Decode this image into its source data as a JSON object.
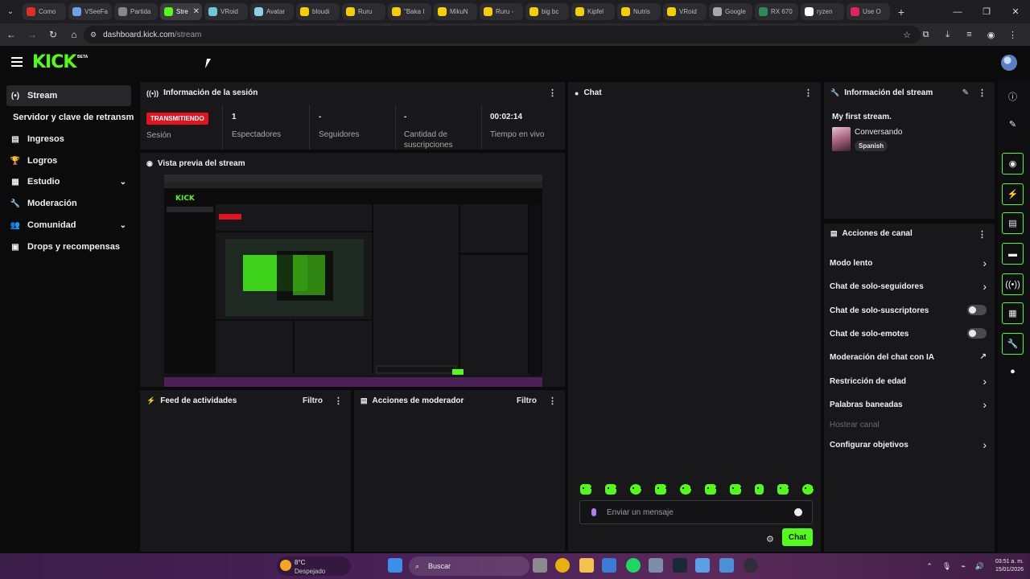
{
  "browser": {
    "tabs": [
      {
        "label": "Como",
        "color": "#e52d27",
        "active": false
      },
      {
        "label": "VSeeFa",
        "color": "#6aa5e8",
        "active": false
      },
      {
        "label": "Partida",
        "color": "#888888",
        "active": false
      },
      {
        "label": "Stre",
        "color": "#53fc18",
        "active": true
      },
      {
        "label": "VRoid",
        "color": "#6ac8d8",
        "active": false
      },
      {
        "label": "Avatar",
        "color": "#8fd0e8",
        "active": false
      },
      {
        "label": "bloudi",
        "color": "#f5d000",
        "active": false
      },
      {
        "label": "Ruru",
        "color": "#f5d000",
        "active": false
      },
      {
        "label": "\"Baka I",
        "color": "#f5d000",
        "active": false
      },
      {
        "label": "MikuN",
        "color": "#f5d000",
        "active": false
      },
      {
        "label": "Ruru -",
        "color": "#f5d000",
        "active": false
      },
      {
        "label": "big bc",
        "color": "#f5d000",
        "active": false
      },
      {
        "label": "Kipfel",
        "color": "#f5d000",
        "active": false
      },
      {
        "label": "Nutris",
        "color": "#f5d000",
        "active": false
      },
      {
        "label": "VRoid",
        "color": "#f5d000",
        "active": false
      },
      {
        "label": "Google",
        "color": "#aaaaaa",
        "active": false
      },
      {
        "label": "RX 670",
        "color": "#2e8b57",
        "active": false
      },
      {
        "label": "ryzen",
        "color": "#ffffff",
        "active": false
      },
      {
        "label": "Use O",
        "color": "#e0245e",
        "active": false
      }
    ],
    "url_domain": "dashboard.kick.com",
    "url_path": "/stream"
  },
  "header": {
    "logo": "KICK",
    "beta": "BETA"
  },
  "sidebar": {
    "items": [
      {
        "label": "Stream",
        "icon": "(•)"
      },
      {
        "label": "Servidor y clave de retransm",
        "icon": ""
      },
      {
        "label": "Ingresos",
        "icon": "▤"
      },
      {
        "label": "Logros",
        "icon": "🏆"
      },
      {
        "label": "Estudio",
        "icon": "▦"
      },
      {
        "label": "Moderación",
        "icon": "🔧"
      },
      {
        "label": "Comunidad",
        "icon": "👥"
      },
      {
        "label": "Drops y recompensas",
        "icon": "▣"
      }
    ]
  },
  "session": {
    "title": "Información de la sesión",
    "status": "TRANSMITIENDO",
    "status_label": "Sesión",
    "viewers": "1",
    "viewers_label": "Espectadores",
    "followers": "-",
    "followers_label": "Seguidores",
    "subs": "-",
    "subs_label": "Cantidad de suscripciones",
    "time": "00:02:14",
    "time_label": "Tiempo en vivo"
  },
  "preview": {
    "title": "Vista previa del stream"
  },
  "activity": {
    "title": "Feed de actividades",
    "filter": "Filtro"
  },
  "modactions": {
    "title": "Acciones de moderador",
    "filter": "Filtro"
  },
  "chat": {
    "title": "Chat",
    "placeholder": "Enviar un mensaje",
    "send": "Chat"
  },
  "streaminfo": {
    "title": "Información del stream",
    "stream_title": "My first stream.",
    "category": "Conversando",
    "language": "Spanish"
  },
  "channel": {
    "title": "Acciones de canal",
    "items": [
      {
        "label": "Modo lento",
        "ctl": "arrow"
      },
      {
        "label": "Chat de solo-seguidores",
        "ctl": "arrow"
      },
      {
        "label": "Chat de solo-suscriptores",
        "ctl": "toggle"
      },
      {
        "label": "Chat de solo-emotes",
        "ctl": "toggle"
      },
      {
        "label": "Moderación del chat con IA",
        "ctl": "external"
      },
      {
        "label": "Restricción de edad",
        "ctl": "arrow"
      },
      {
        "label": "Palabras baneadas",
        "ctl": "arrow"
      },
      {
        "label": "Hostear canal",
        "ctl": "none"
      },
      {
        "label": "Configurar objetivos",
        "ctl": "arrow"
      }
    ]
  },
  "taskbar": {
    "temp": "8°C",
    "weather": "Despejado",
    "search": "Buscar",
    "time": "03:51 a. m.",
    "date": "15/01/2026"
  }
}
